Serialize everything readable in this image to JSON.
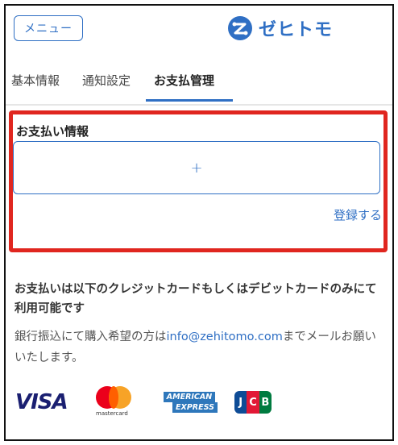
{
  "header": {
    "menu_label": "メニュー",
    "logo_text": "ゼヒトモ",
    "logo_icon": "zehitomo-logo-icon",
    "accent_color": "#2f6fc4"
  },
  "tabs": [
    {
      "label": "基本情報",
      "active": false
    },
    {
      "label": "通知設定",
      "active": false
    },
    {
      "label": "お支払管理",
      "active": true
    }
  ],
  "payment": {
    "title": "お支払い情報",
    "add_icon": "plus-icon",
    "add_symbol": "+",
    "register_label": "登録する",
    "highlight_color": "#e0261f"
  },
  "notice": {
    "strong_text": "お支払いは以下のクレジットカードもしくはデビットカードのみにて利用可能です",
    "text_before": "銀行振込にて購入希望の方は",
    "email": "info@zehitomo.com",
    "text_after": "までメールお願いいたします。"
  },
  "brands": {
    "visa": "VISA",
    "mastercard": "mastercard",
    "amex_line1": "AMERICAN",
    "amex_line2": "EXPRESS",
    "jcb": [
      "J",
      "C",
      "B"
    ]
  }
}
